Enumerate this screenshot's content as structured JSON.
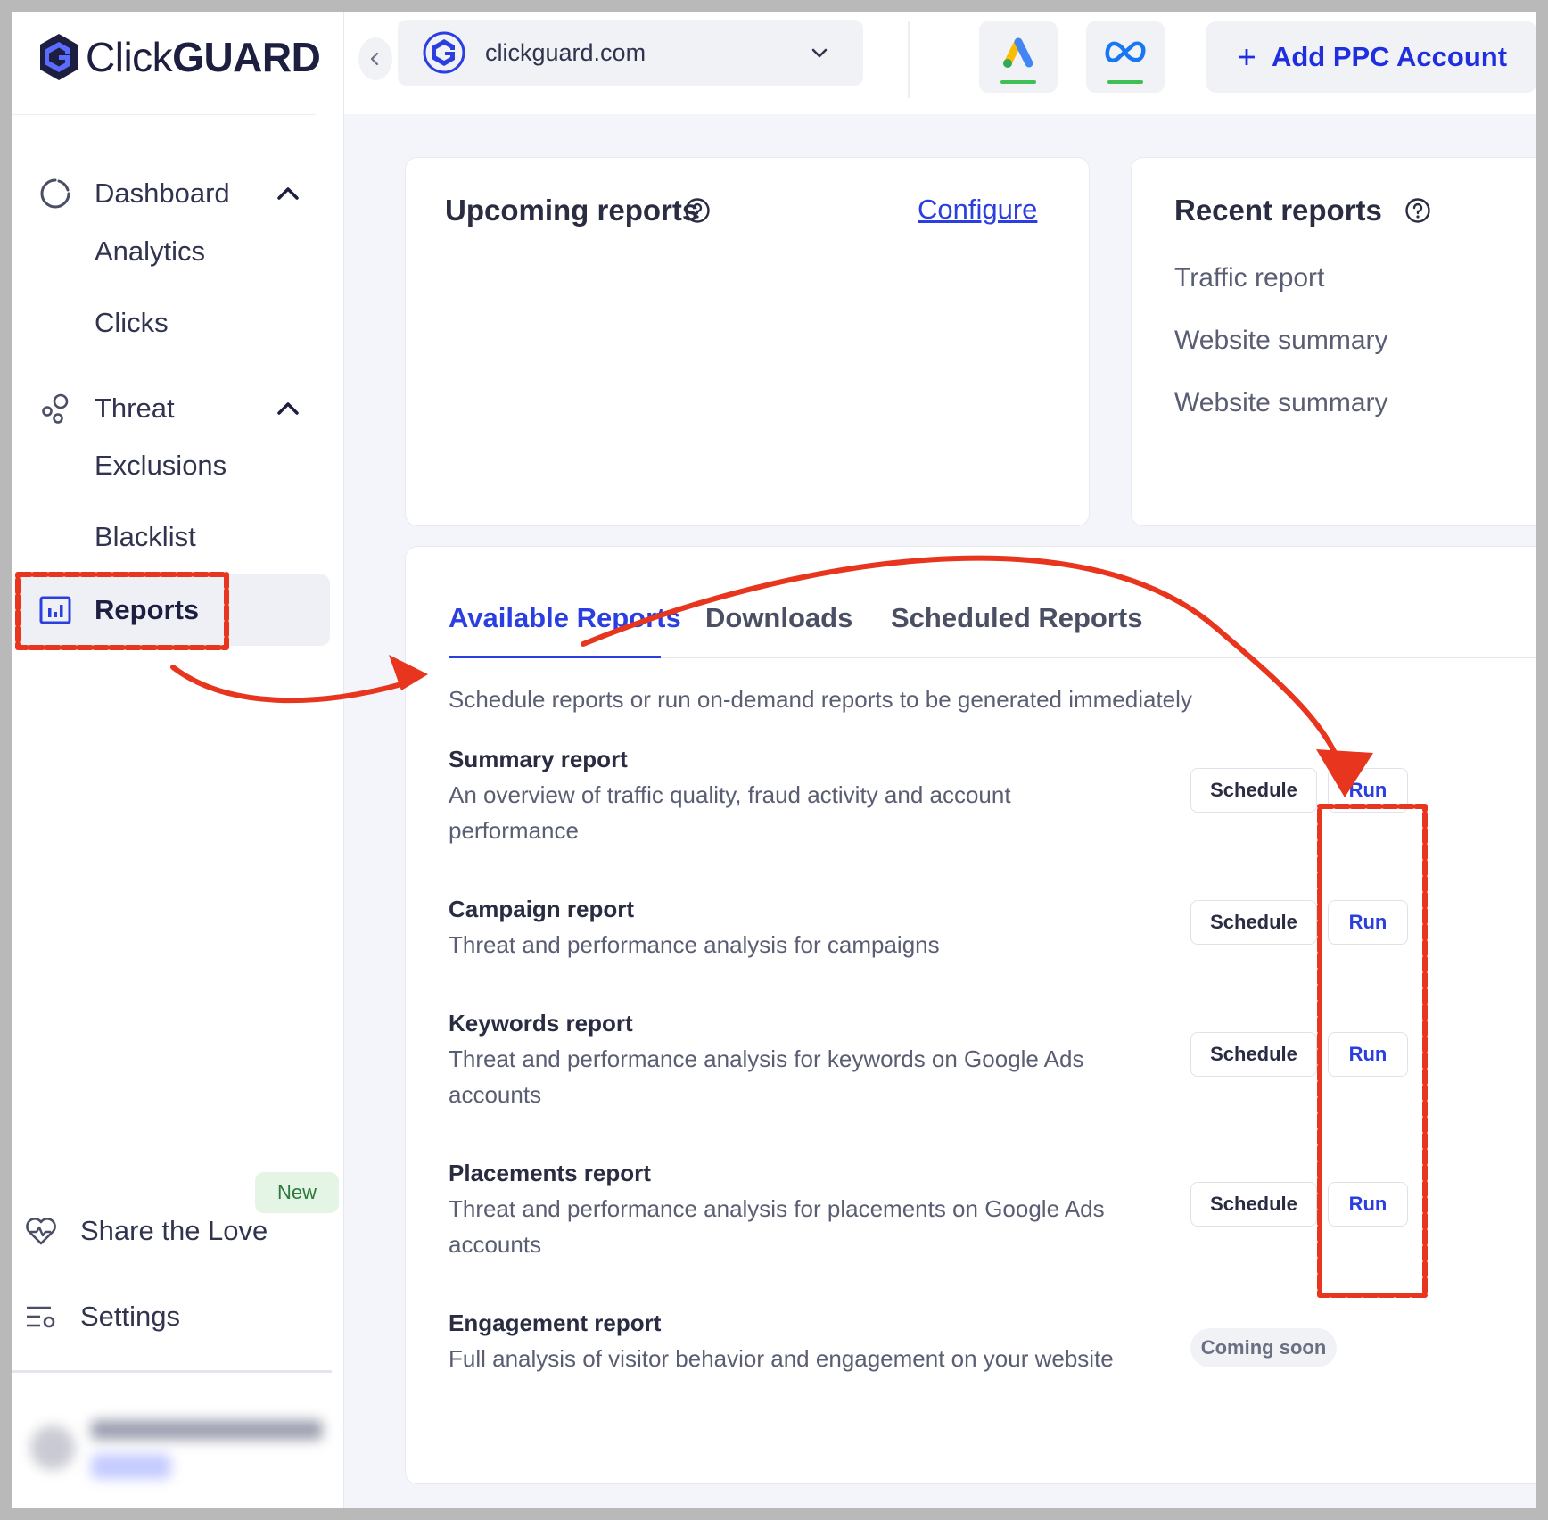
{
  "brand": {
    "logo_text_light": "Click",
    "logo_text_bold": "GUARD"
  },
  "colors": {
    "accent": "#2b3fe0",
    "annotation": "#e8361e",
    "success": "#3fbf55"
  },
  "sidebar": {
    "items": [
      {
        "label": "Dashboard",
        "icon": "dashboard-icon",
        "expanded": true,
        "children": [
          "Analytics",
          "Clicks"
        ]
      },
      {
        "label": "Threat",
        "icon": "threat-icon",
        "expanded": true,
        "children": [
          "Exclusions",
          "Blacklist"
        ]
      },
      {
        "label": "Reports",
        "icon": "reports-icon",
        "active": true
      }
    ],
    "share": {
      "label": "Share the Love",
      "icon": "heart-icon",
      "badge": "New"
    },
    "settings": {
      "label": "Settings",
      "icon": "settings-icon"
    }
  },
  "topbar": {
    "site": "clickguard.com",
    "platforms": [
      {
        "icon": "google-ads-icon"
      },
      {
        "icon": "meta-icon"
      }
    ],
    "add_ppc_label": "Add PPC Account"
  },
  "upcoming": {
    "title": "Upcoming reports",
    "configure_label": "Configure"
  },
  "recent": {
    "title": "Recent reports",
    "items": [
      "Traffic report",
      "Website summary",
      "Website summary"
    ]
  },
  "tabs": {
    "items": [
      "Available Reports",
      "Downloads",
      "Scheduled Reports"
    ],
    "active": 0
  },
  "intro": "Schedule reports or run on-demand reports to be generated immediately",
  "reports": [
    {
      "title": "Summary report",
      "desc": "An overview of traffic quality, fraud activity and account performance",
      "schedule": "Schedule",
      "run": "Run"
    },
    {
      "title": "Campaign report",
      "desc": "Threat and performance analysis for campaigns",
      "schedule": "Schedule",
      "run": "Run"
    },
    {
      "title": "Keywords report",
      "desc": "Threat and performance analysis for keywords on Google Ads accounts",
      "schedule": "Schedule",
      "run": "Run"
    },
    {
      "title": "Placements report",
      "desc": "Threat and performance analysis for placements on Google Ads accounts",
      "schedule": "Schedule",
      "run": "Run"
    },
    {
      "title": "Engagement report",
      "desc": "Full analysis of visitor behavior and engagement on your website",
      "status": "Coming soon"
    }
  ]
}
